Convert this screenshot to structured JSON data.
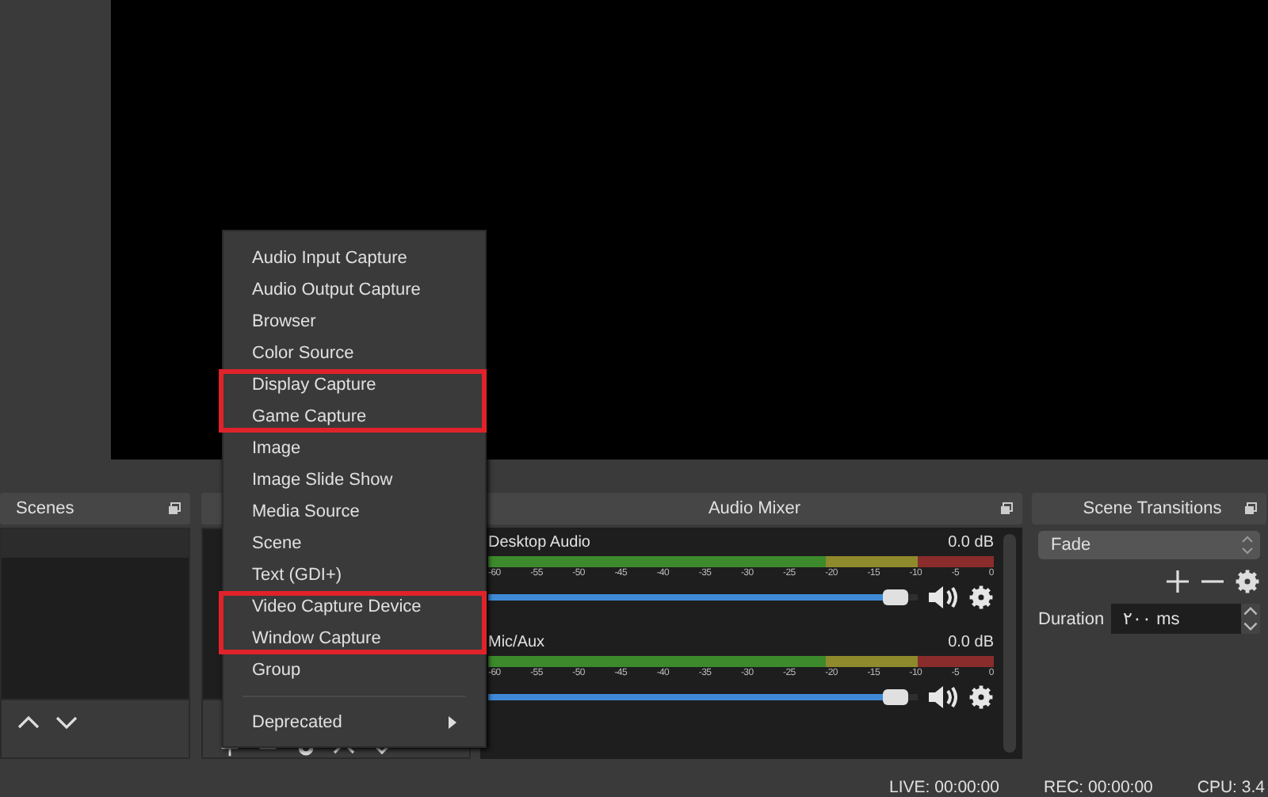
{
  "scenes_dock": {
    "title": "Scenes"
  },
  "audio_mixer": {
    "title": "Audio Mixer",
    "channels": [
      {
        "name": "Desktop Audio",
        "reading": "0.0 dB",
        "level": 0.95,
        "muted": false,
        "ticks": [
          "-60",
          "-55",
          "-50",
          "-45",
          "-40",
          "-35",
          "-30",
          "-25",
          "-20",
          "-15",
          "-10",
          "-5",
          "0"
        ]
      },
      {
        "name": "Mic/Aux",
        "reading": "0.0 dB",
        "level": 0.95,
        "muted": false,
        "ticks": [
          "-60",
          "-55",
          "-50",
          "-45",
          "-40",
          "-35",
          "-30",
          "-25",
          "-20",
          "-15",
          "-10",
          "-5",
          "0"
        ]
      }
    ]
  },
  "scene_transitions": {
    "title": "Scene Transitions",
    "transition": "Fade",
    "duration_label": "Duration",
    "duration": "٢٠٠ ms"
  },
  "context_menu": {
    "sections": [
      {
        "kind": "group",
        "highlighted": false,
        "items": [
          {
            "label": "Audio Input Capture",
            "submenu": false
          },
          {
            "label": "Audio Output Capture",
            "submenu": false
          },
          {
            "label": "Browser",
            "submenu": false
          },
          {
            "label": "Color Source",
            "submenu": false
          }
        ]
      },
      {
        "kind": "group",
        "highlighted": true,
        "items": [
          {
            "label": "Display Capture",
            "submenu": false
          },
          {
            "label": "Game Capture",
            "submenu": false
          }
        ]
      },
      {
        "kind": "group",
        "highlighted": false,
        "items": [
          {
            "label": "Image",
            "submenu": false
          },
          {
            "label": "Image Slide Show",
            "submenu": false
          },
          {
            "label": "Media Source",
            "submenu": false
          },
          {
            "label": "Scene",
            "submenu": false
          },
          {
            "label": "Text (GDI+)",
            "submenu": false
          }
        ]
      },
      {
        "kind": "group",
        "highlighted": true,
        "items": [
          {
            "label": "Video Capture Device",
            "submenu": false
          },
          {
            "label": "Window Capture",
            "submenu": false
          }
        ]
      },
      {
        "kind": "group",
        "highlighted": false,
        "items": [
          {
            "label": "Group",
            "submenu": false
          }
        ]
      },
      {
        "kind": "separator"
      },
      {
        "kind": "group",
        "highlighted": false,
        "items": [
          {
            "label": "Deprecated",
            "submenu": true
          }
        ]
      }
    ]
  },
  "status_bar": [
    "LIVE: 00:00:00",
    "REC: 00:00:00",
    "CPU: 3.4"
  ]
}
